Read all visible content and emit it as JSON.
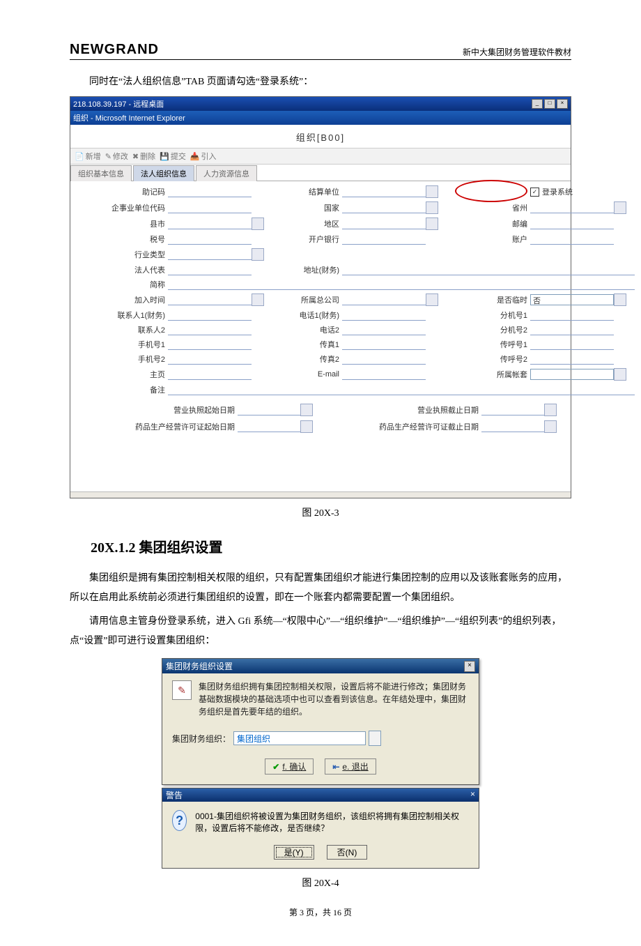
{
  "header": {
    "brand": "NEWGRAND",
    "doctitle": "新中大集团财务管理软件教材"
  },
  "intro_para": "同时在“法人组织信息”TAB 页面请勾选“登录系统”：",
  "shot1": {
    "rdp_title": "218.108.39.197 - 远程桌面",
    "ie_title": "组织 - Microsoft Internet Explorer",
    "page_heading": "组织[B00]",
    "toolbar": {
      "new": "新增",
      "edit": "修改",
      "del": "删除",
      "submit": "提交",
      "import": "引入"
    },
    "tabs": {
      "t1": "组织基本信息",
      "t2": "法人组织信息",
      "t3": "人力资源信息"
    },
    "labels": {
      "zjm": "助记码",
      "jsdw": "结算单位",
      "dlxt": "登录系统",
      "qydw": "企事业单位代码",
      "gj": "国家",
      "sz": "省州",
      "xs": "县市",
      "dq": "地区",
      "yb": "邮编",
      "sh": "税号",
      "khyh": "开户银行",
      "zh": "账户",
      "hylx": "行业类型",
      "frdb": "法人代表",
      "dzcw": "地址(财务)",
      "jc": "简称",
      "jrsj": "加入时间",
      "sszgs": "所属总公司",
      "sfls": "是否临时",
      "fo": "否",
      "lxr1": "联系人1(财务)",
      "dh1": "电话1(财务)",
      "fj1": "分机号1",
      "lxr2": "联系人2",
      "dh2": "电话2",
      "fj2": "分机号2",
      "sjh1": "手机号1",
      "cz1": "传真1",
      "chh1": "传呼号1",
      "sjh2": "手机号2",
      "cz2": "传真2",
      "chh2": "传呼号2",
      "zy": "主页",
      "email": "E-mail",
      "sszt": "所属帐套",
      "bz": "备注",
      "yyzzqs": "营业执照起始日期",
      "yyzzjz": "营业执照截止日期",
      "ypxkqs": "药品生产经营许可证起始日期",
      "ypxkjz": "药品生产经营许可证截止日期"
    }
  },
  "caption1": "图 20X-3",
  "section_title": "20X.1.2 集团组织设置",
  "body_p1": "集团组织是拥有集团控制相关权限的组织，只有配置集团组织才能进行集团控制的应用以及该账套账务的应用，所以在启用此系统前必须进行集团组织的设置，即在一个账套内都需要配置一个集团组织。",
  "body_p2": "请用信息主管身份登录系统，进入 Gfi 系统—“权限中心”—“组织维护”—“组织维护”—“组织列表”的组织列表，点“设置”即可进行设置集团组织：",
  "shot2": {
    "dlg_title": "集团财务组织设置",
    "dlg_msg": "集团财务组织拥有集团控制相关权限，设置后将不能进行修改；集团财务基础数据模块的基础选项中也可以查看到该信息。在年结处理中，集团财务组织是首先要年结的组织。",
    "sel_label": "集团财务组织：",
    "sel_value": "集团组织",
    "btn_ok": "f. 确认",
    "btn_exit": "e. 退出",
    "warn_title": "警告",
    "warn_msg": "0001-集团组织将被设置为集团财务组织，该组织将拥有集团控制相关权限，设置后将不能修改，是否继续？",
    "yes": "是(Y)",
    "no": "否(N)"
  },
  "caption2": "图 20X-4",
  "footer": "第 3 页，共 16 页"
}
